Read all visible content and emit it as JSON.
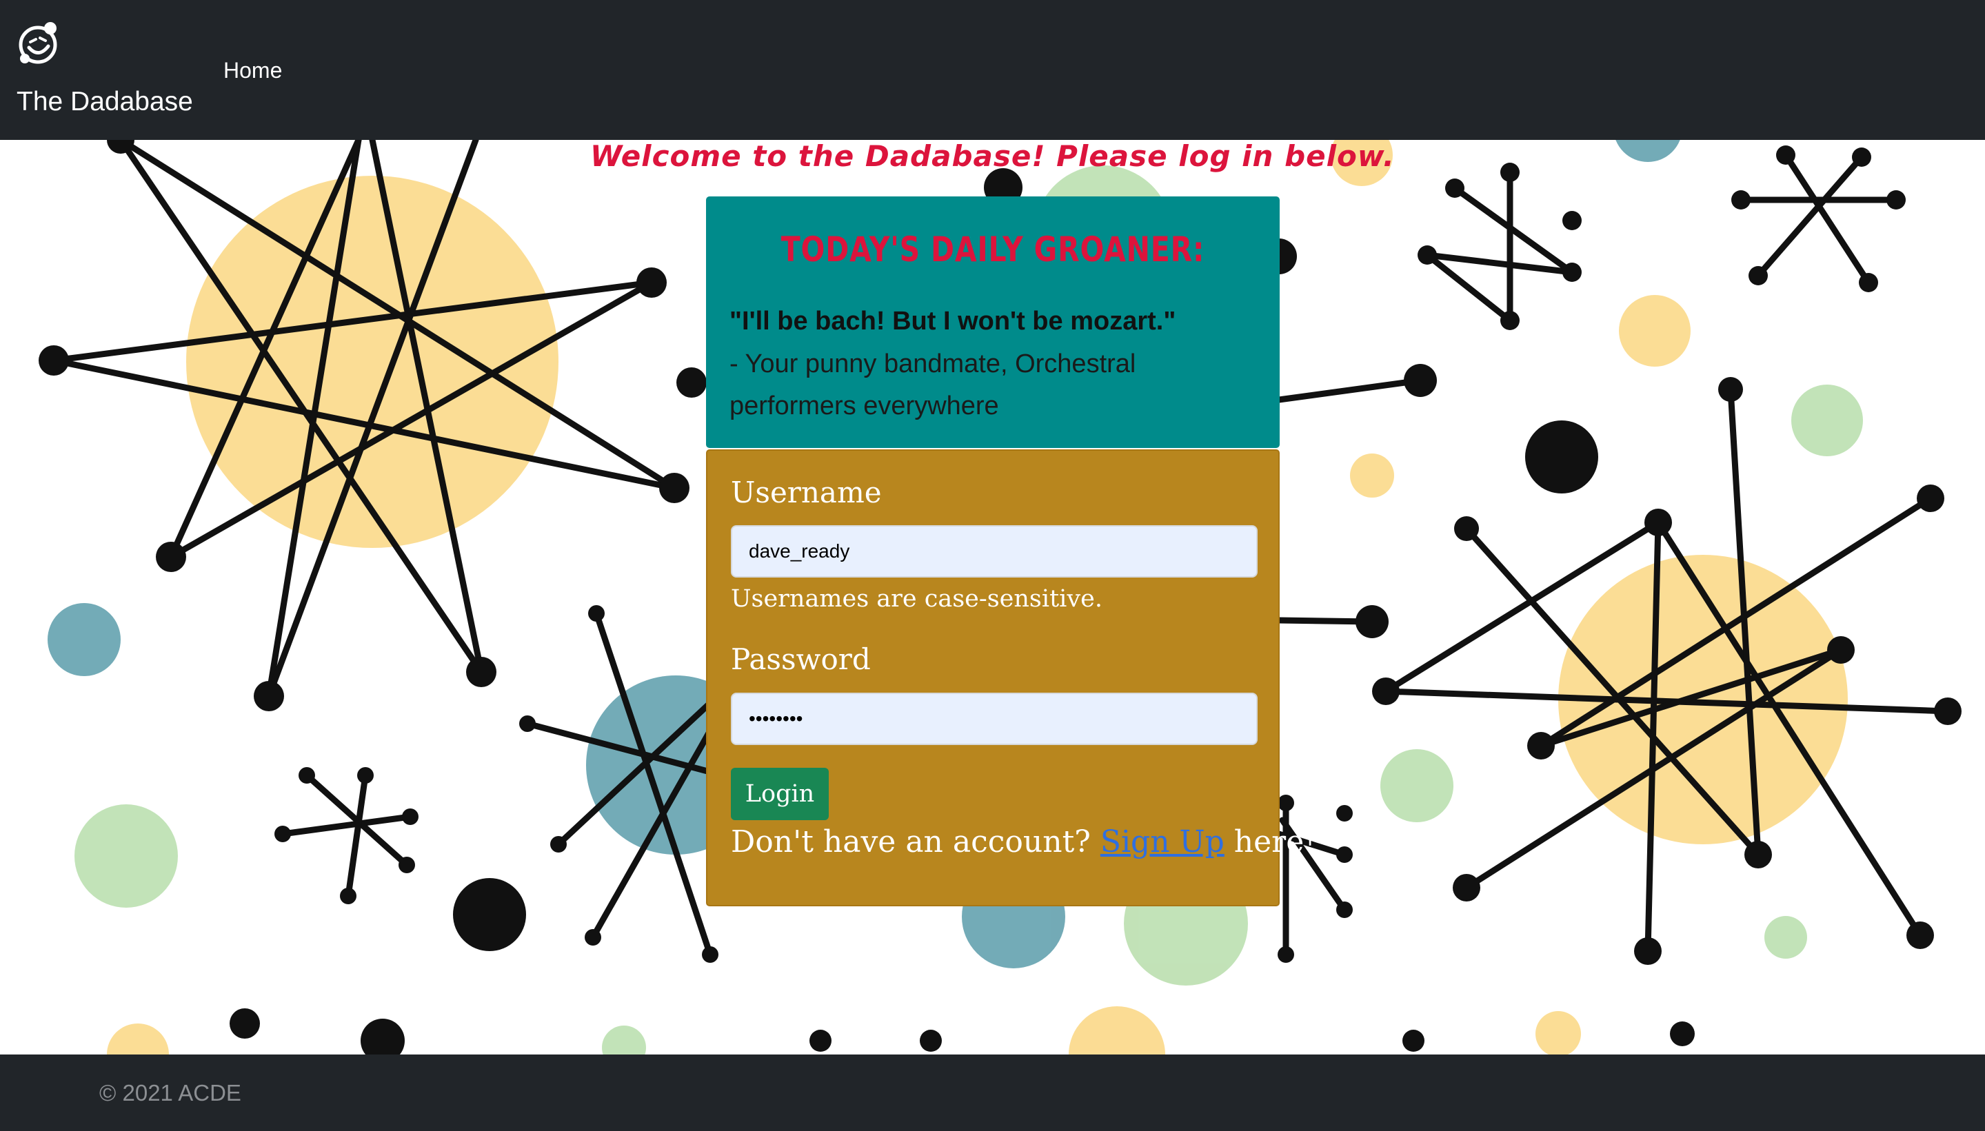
{
  "nav": {
    "brand": "The Dadabase",
    "home_link": "Home"
  },
  "welcome": "Welcome to the Dadabase! Please log in below.",
  "groaner": {
    "title": "TODAY'S DAILY GROANER:",
    "quote": "\"I'll be bach! But I won't be mozart.\"",
    "attribution": "- Your punny bandmate, Orchestral performers everywhere"
  },
  "login": {
    "username_label": "Username",
    "username_value": "dave_ready",
    "username_help": "Usernames are case-sensitive.",
    "password_label": "Password",
    "password_value": "••••••••",
    "login_button": "Login",
    "signup_prefix": "Don't have an account?",
    "signup_link": "Sign Up",
    "signup_suffix": "here!"
  },
  "footer": {
    "copyright": "© 2021 ACDE"
  },
  "colors": {
    "navbar": "#212529",
    "groaner_card": "#008b8b",
    "login_card": "#b8861e",
    "accent_red": "#dc143c",
    "login_button": "#198754",
    "link": "#2f6fe0"
  }
}
